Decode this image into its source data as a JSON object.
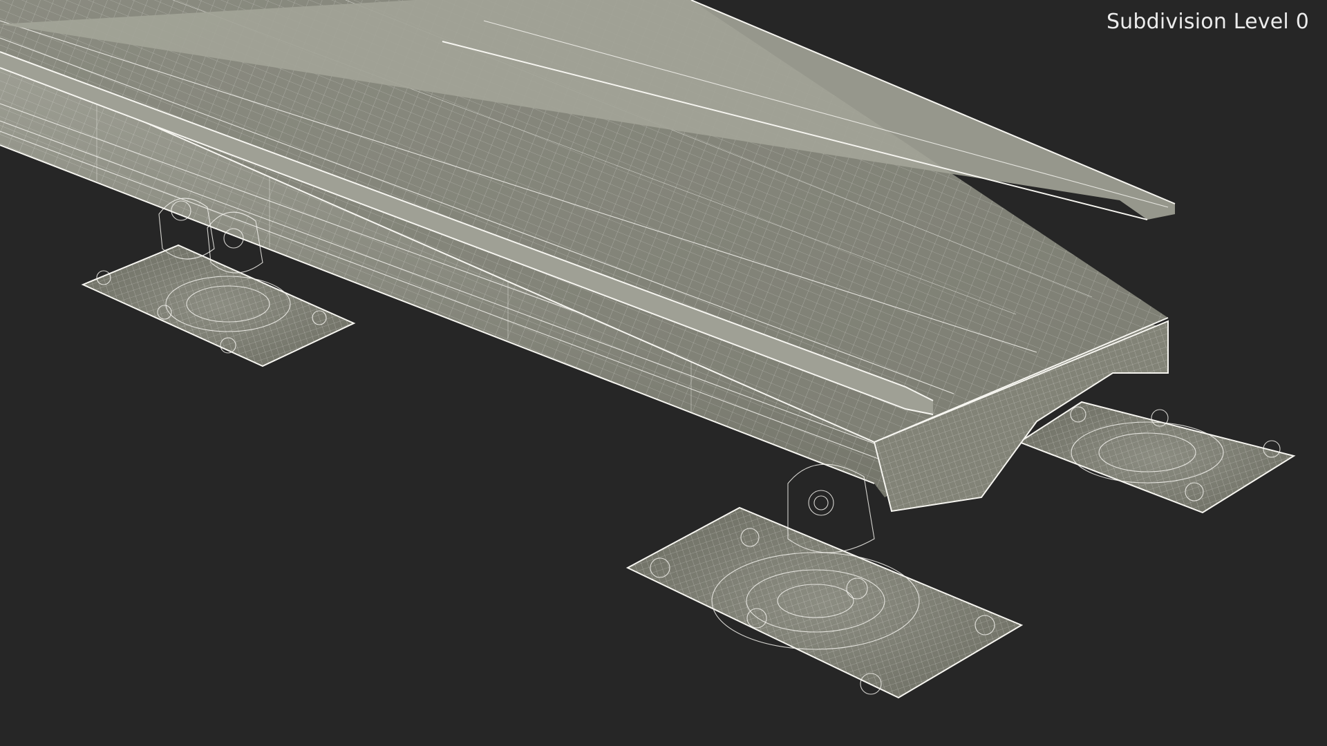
{
  "overlay": {
    "subdivision_label": "Subdivision Level 0"
  },
  "colors": {
    "background": "#262626",
    "mesh_surface": "#86877a",
    "mesh_surface_light": "#9c9d91",
    "mesh_surface_dark": "#6e6f64",
    "wireframe": "#f4f3ee"
  }
}
